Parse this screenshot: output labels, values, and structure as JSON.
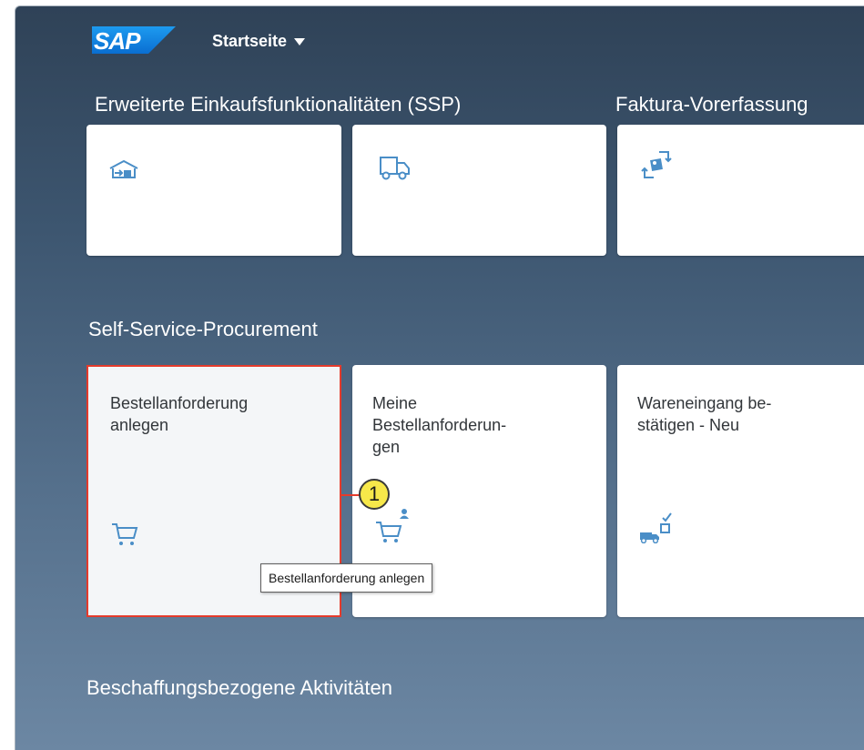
{
  "shell": {
    "logo_text": "SAP",
    "home_menu_label": "Startseite"
  },
  "groups": [
    {
      "title": "Erweiterte Einkaufsfunktionalitäten (SSP)"
    },
    {
      "title": "Faktura-Vorerfassung"
    },
    {
      "title": "Self-Service-Procurement"
    },
    {
      "title": "Beschaffungsbezogene Aktivitäten"
    }
  ],
  "top_tiles": [
    {
      "icon": "warehouse-inbound-icon"
    },
    {
      "icon": "truck-icon"
    },
    {
      "icon": "package-transfer-icon"
    }
  ],
  "ssp_tiles": [
    {
      "title": "Bestellanforderung\nanlegen",
      "icon": "shopping-cart-icon"
    },
    {
      "title": "Meine\nBestellanforderun-\ngen",
      "icon": "cart-user-icon"
    },
    {
      "title": "Wareneingang be-\nstätigen - Neu",
      "icon": "truck-confirm-icon"
    }
  ],
  "annotation": {
    "callout_number": "1",
    "tooltip_text": "Bestellanforderung anlegen"
  },
  "colors": {
    "icon_blue": "#4a8ec7",
    "highlight_red": "#e53b2c",
    "callout_yellow": "#f7e84a"
  }
}
